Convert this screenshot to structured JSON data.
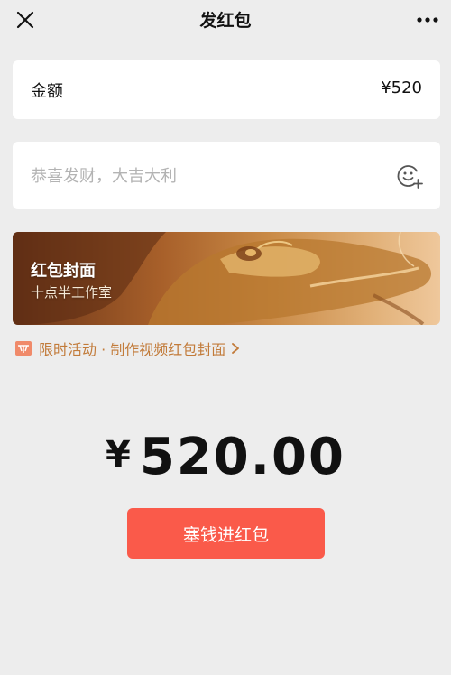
{
  "header": {
    "title": "发红包",
    "close_icon": "close-icon",
    "more_icon": "more-icon"
  },
  "amount": {
    "label": "金额",
    "value": "¥520"
  },
  "greeting": {
    "placeholder": "恭喜发财，大吉大利",
    "emoji_icon": "emoji-add-icon"
  },
  "cover": {
    "title": "红包封面",
    "subtitle": "十点半工作室"
  },
  "promo": {
    "icon": "gift-icon",
    "text": "限时活动 · 制作视频红包封面",
    "chevron_icon": "chevron-right-icon"
  },
  "total": {
    "currency": "¥",
    "amount": "520.00"
  },
  "send_button": {
    "label": "塞钱进红包"
  },
  "colors": {
    "background": "#ededed",
    "card": "#ffffff",
    "accent_button": "#fa5a4a",
    "promo_text": "#c27b3a",
    "placeholder": "#b3b3b3"
  }
}
